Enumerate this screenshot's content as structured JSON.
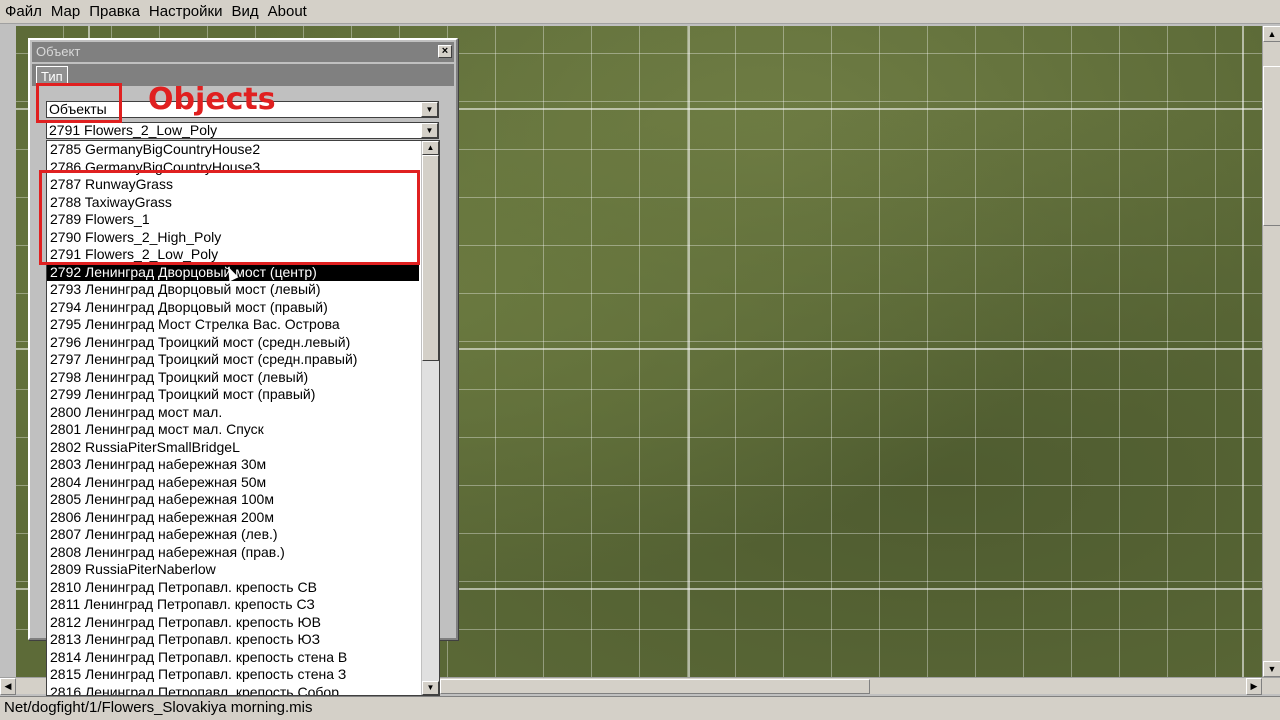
{
  "menu": [
    "Файл",
    "Мар",
    "Правка",
    "Настройки",
    "Вид",
    "About"
  ],
  "dialog": {
    "title": "Объект",
    "close_icon": "×",
    "tab": "Тип",
    "category_combo": "Объекты",
    "object_combo": "2791 Flowers_2_Low_Poly"
  },
  "annotation": {
    "label": "Objects",
    "color": "#e02020"
  },
  "object_list": [
    "2785 GermanyBigCountryHouse2",
    "2786 GermanyBigCountryHouse3",
    "2787 RunwayGrass",
    "2788 TaxiwayGrass",
    "2789 Flowers_1",
    "2790 Flowers_2_High_Poly",
    "2791 Flowers_2_Low_Poly",
    "2792 Ленинград Дворцовый мост (центр)",
    "2793 Ленинград Дворцовый мост (левый)",
    "2794 Ленинград Дворцовый мост (правый)",
    "2795 Ленинград Мост Стрелка Вас. Острова",
    "2796 Ленинград Троицкий мост (средн.левый)",
    "2797 Ленинград Троицкий мост (средн.правый)",
    "2798 Ленинград Троицкий мост (левый)",
    "2799 Ленинград Троицкий мост (правый)",
    "2800 Ленинград мост мал.",
    "2801 Ленинград мост мал. Спуск",
    "2802 RussiaPiterSmallBridgeL",
    "2803 Ленинград набережная 30м",
    "2804 Ленинград набережная 50м",
    "2805 Ленинград набережная 100м",
    "2806 Ленинград набережная 200м",
    "2807 Ленинград набережная (лев.)",
    "2808 Ленинград набережная (прав.)",
    "2809 RussiaPiterNaberlow",
    "2810 Ленинград Петропавл. крепость СВ",
    "2811 Ленинград Петропавл. крепость СЗ",
    "2812 Ленинград Петропавл. крепость ЮВ",
    "2813 Ленинград Петропавл. крепость ЮЗ",
    "2814 Ленинград Петропавл. крепость стена В",
    "2815 Ленинград Петропавл. крепость стена З",
    "2816 Ленинград Петропавл. крепость Собор"
  ],
  "selected_index": 7,
  "status": "Net/dogfight/1/Flowers_Slovakiya morning.mis"
}
